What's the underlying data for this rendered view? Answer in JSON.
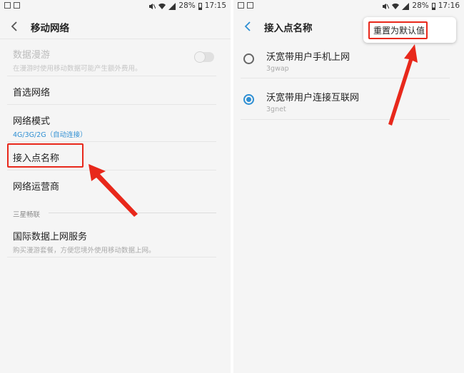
{
  "left": {
    "status": {
      "battery": "28%",
      "time": "17:15"
    },
    "toolbar_title": "移动网络",
    "items": [
      {
        "title": "数据漫游",
        "sub": "在漫游时使用移动数据可能产生额外费用。"
      },
      {
        "title": "首选网络"
      },
      {
        "title": "网络模式",
        "sub": "4G/3G/2G（自动连接）"
      },
      {
        "title": "接入点名称"
      },
      {
        "title": "网络运营商"
      }
    ],
    "section_header": "三星畅联",
    "intl": {
      "title": "国际数据上网服务",
      "sub": "购买漫游套餐，方便您境外使用移动数据上网。"
    }
  },
  "right": {
    "status": {
      "battery": "28%",
      "time": "17:16"
    },
    "toolbar_title": "接入点名称",
    "menu_item": "重置为默认值",
    "apns": [
      {
        "name": "沃宽带用户手机上网",
        "apn": "3gwap",
        "selected": false
      },
      {
        "name": "沃宽带用户连接互联网",
        "apn": "3gnet",
        "selected": true
      }
    ]
  },
  "colors": {
    "accent": "#2f8fd3",
    "annotation": "#e8281b"
  }
}
